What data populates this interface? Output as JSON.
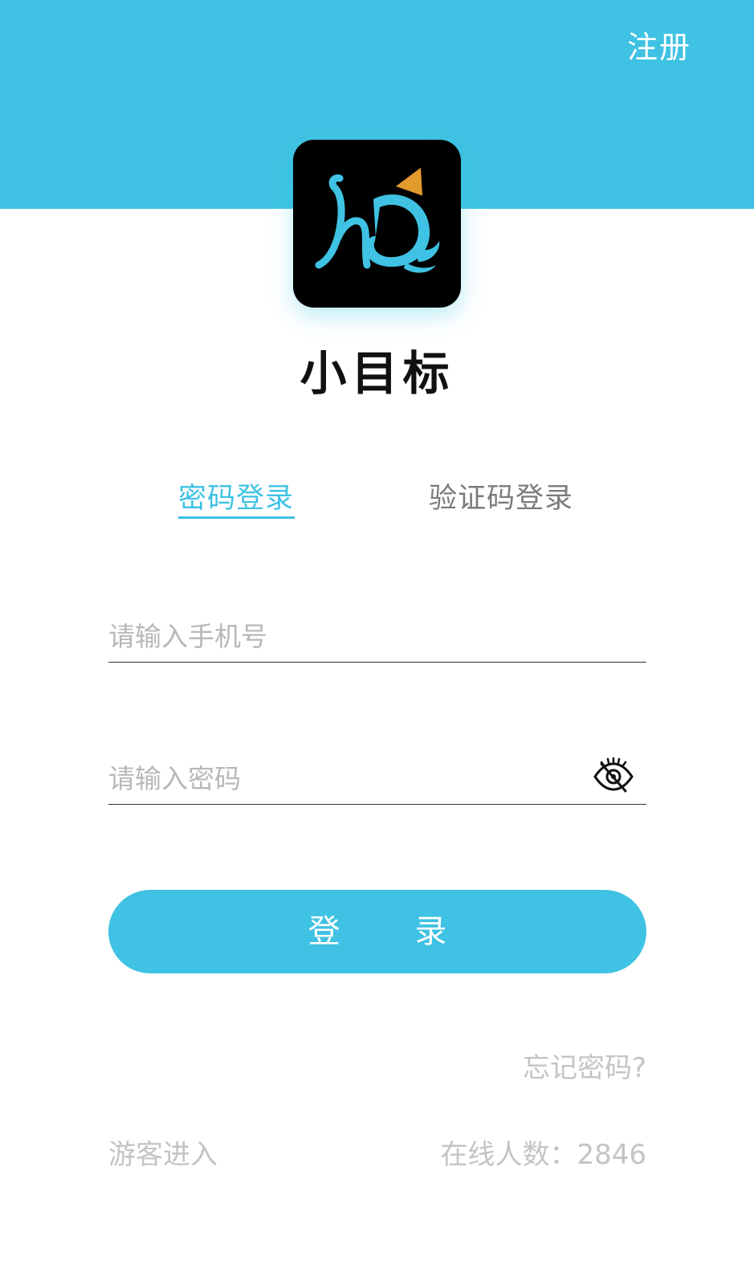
{
  "header": {
    "register_label": "注册"
  },
  "app": {
    "name": "小目标",
    "logo_icon": "app-logo-icon"
  },
  "tabs": [
    {
      "label": "密码登录",
      "active": true
    },
    {
      "label": "验证码登录",
      "active": false
    }
  ],
  "form": {
    "phone_placeholder": "请输入手机号",
    "phone_value": "",
    "password_placeholder": "请输入密码",
    "password_value": "",
    "visibility_icon": "eye-off-icon",
    "login_label": "登 录"
  },
  "footer": {
    "forgot_label": "忘记密码?",
    "guest_label": "游客进入",
    "online_label": "在线人数：",
    "online_count": "2846"
  },
  "colors": {
    "accent": "#3fc2e3",
    "muted_text": "#c4c4c4",
    "tab_inactive": "#7b7b7b"
  }
}
